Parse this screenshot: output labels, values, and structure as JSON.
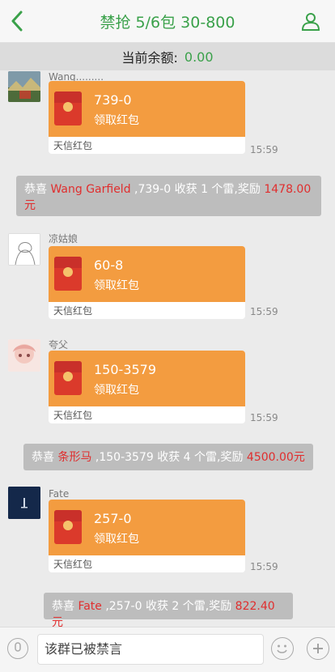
{
  "header": {
    "title": "禁抢 5/6包 30-800",
    "back_icon": "chevron-left-icon",
    "profile_icon": "user-icon"
  },
  "balance": {
    "label": "当前余额:",
    "amount": "0.00"
  },
  "messages": [
    {
      "sender": "Wang.........",
      "packet_title": "739-0",
      "packet_sub": "领取红包",
      "brand": "天信红包",
      "time": "15:59"
    },
    {
      "sender": "凉姑娘",
      "packet_title": "60-8",
      "packet_sub": "领取红包",
      "brand": "天信红包",
      "time": "15:59"
    },
    {
      "sender": "夸父",
      "packet_title": "150-3579",
      "packet_sub": "领取红包",
      "brand": "天信红包",
      "time": "15:59"
    },
    {
      "sender": "Fate",
      "packet_title": "257-0",
      "packet_sub": "领取红包",
      "brand": "天信红包",
      "time": "15:59"
    }
  ],
  "notices": [
    {
      "prefix": "恭喜",
      "name": "Wang Garfield",
      "text": ",739-0 收获 1 个雷,奖励",
      "reward": "1478.00",
      "unit": "元"
    },
    {
      "prefix": "恭喜",
      "name": "条形马",
      "text": ",150-3579 收获 4 个雷,奖励",
      "reward": "4500.00元"
    },
    {
      "prefix": "恭喜",
      "name": "Fate",
      "text": ",257-0 收获 2 个雷,奖励",
      "reward": "822.40元"
    }
  ],
  "footer": {
    "input_placeholder": "该群已被禁言"
  },
  "colors": {
    "accent": "#3aa14a",
    "packet": "#f39c40",
    "envelope": "#db3a2b",
    "reward": "#e02e2e"
  }
}
